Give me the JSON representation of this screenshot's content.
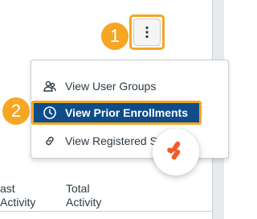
{
  "colors": {
    "badge": "#f5a623",
    "highlight_bg": "#0e4c8a",
    "text": "#2d3b45",
    "fab_accent": "#f05a28"
  },
  "badges": {
    "step1": "1",
    "step2": "2"
  },
  "kebab_button": {
    "icon": "kebab-vertical-icon"
  },
  "menu": {
    "items": [
      {
        "label": "View User Groups",
        "icon": "user-groups-icon"
      },
      {
        "label": "View Prior Enrollments",
        "icon": "clock-icon"
      },
      {
        "label": "View Registered Se",
        "icon": "link-icon"
      }
    ]
  },
  "fab": {
    "icon": "chat-logo-icon"
  },
  "table": {
    "headers": [
      {
        "line1": "ast",
        "line2": "Activity"
      },
      {
        "line1": "Total",
        "line2": "Activity"
      }
    ]
  }
}
